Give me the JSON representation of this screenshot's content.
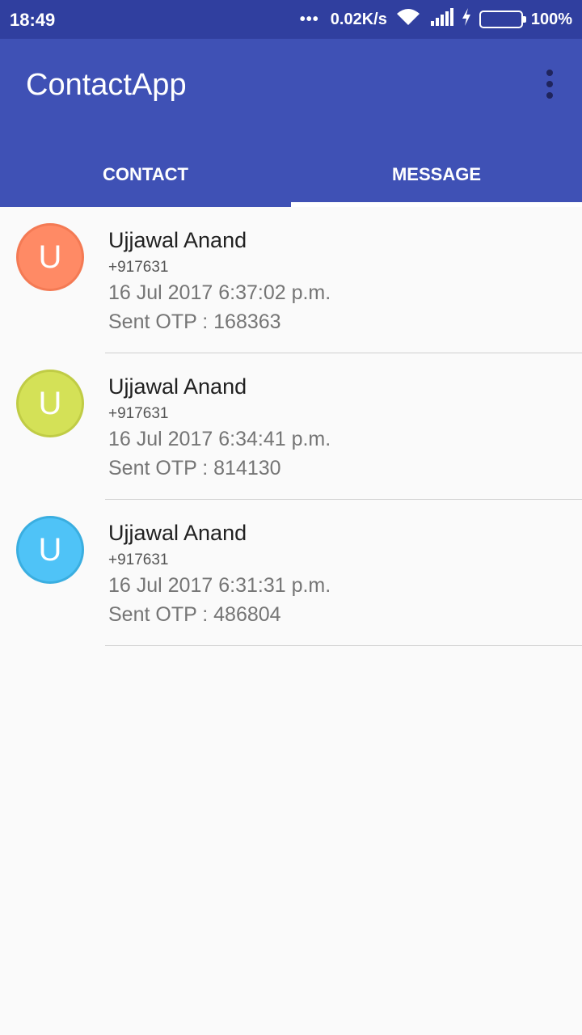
{
  "status_bar": {
    "time": "18:49",
    "dots": "•••",
    "network_speed": "0.02K/s",
    "battery": "100%",
    "icons": [
      "wifi-icon",
      "signal-icon",
      "charging-icon",
      "battery-icon"
    ]
  },
  "app_bar": {
    "title": "ContactApp",
    "menu_icon": "more-vert-icon",
    "color": "#3f51b5"
  },
  "tabs": [
    {
      "label": "CONTACT",
      "active": false
    },
    {
      "label": "MESSAGE",
      "active": true
    }
  ],
  "messages": [
    {
      "initial": "U",
      "name": "Ujjawal Anand",
      "phone": "+917631",
      "date": "16 Jul 2017 6:37:02 p.m.",
      "otp": "Sent OTP : 168363",
      "color": "#ff8a65",
      "border": "#f47a54"
    },
    {
      "initial": "U",
      "name": "Ujjawal Anand",
      "phone": "+917631",
      "date": "16 Jul 2017 6:34:41 p.m.",
      "otp": "Sent OTP : 814130",
      "color": "#d4e157",
      "border": "#c0cc45"
    },
    {
      "initial": "U",
      "name": "Ujjawal Anand",
      "phone": "+917631",
      "date": "16 Jul 2017 6:31:31 p.m.",
      "otp": "Sent OTP : 486804",
      "color": "#4fc3f7",
      "border": "#3aaee0"
    }
  ]
}
